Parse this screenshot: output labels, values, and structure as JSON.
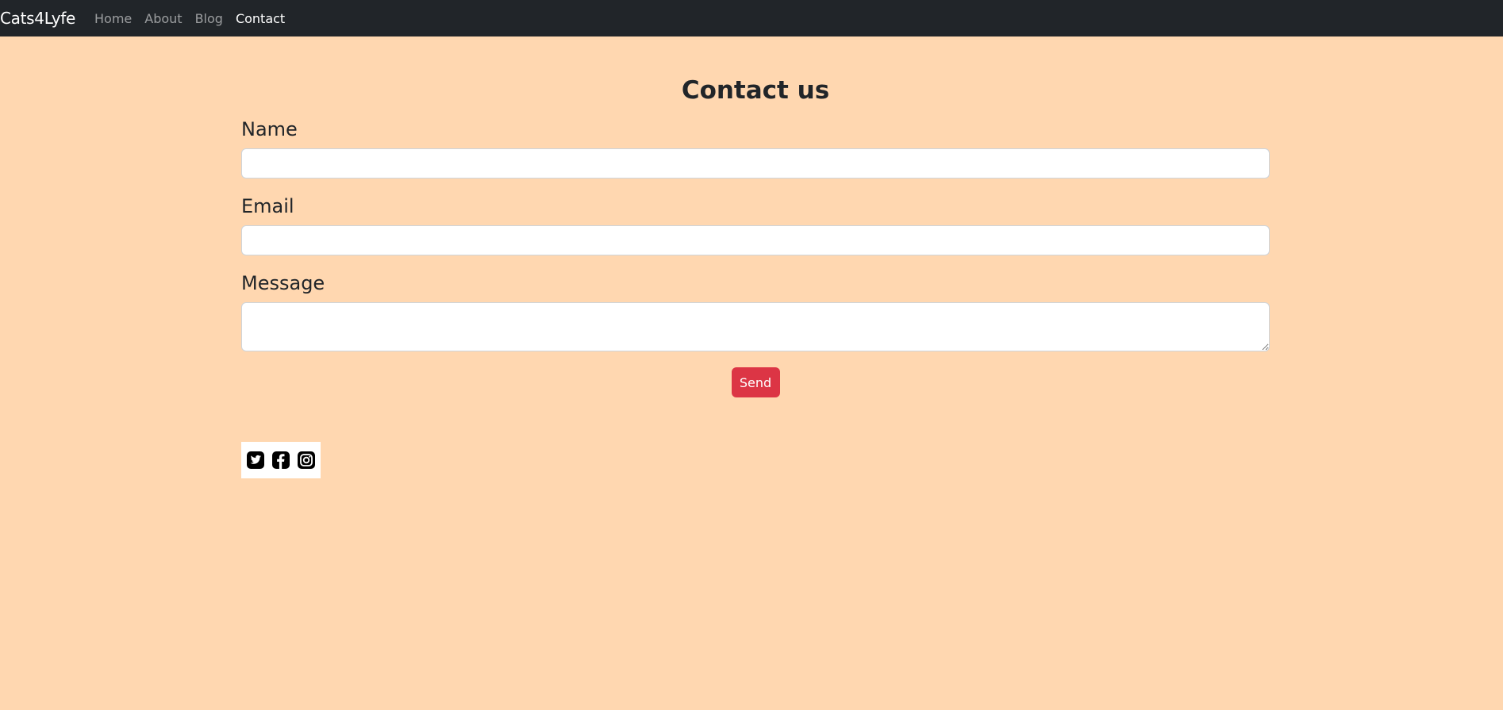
{
  "navbar": {
    "brand": "Cats4Lyfe",
    "links": [
      {
        "label": "Home",
        "active": false
      },
      {
        "label": "About",
        "active": false
      },
      {
        "label": "Blog",
        "active": false
      },
      {
        "label": "Contact",
        "active": true
      }
    ]
  },
  "main": {
    "title": "Contact us",
    "form": {
      "name_label": "Name",
      "name_value": "",
      "email_label": "Email",
      "email_value": "",
      "message_label": "Message",
      "message_value": "",
      "send_label": "Send"
    },
    "socials": [
      {
        "icon": "twitter-icon"
      },
      {
        "icon": "facebook-icon"
      },
      {
        "icon": "instagram-icon"
      }
    ]
  },
  "colors": {
    "page_background": "#ffd7b0",
    "navbar_background": "#212529",
    "send_button": "#dc3545"
  }
}
